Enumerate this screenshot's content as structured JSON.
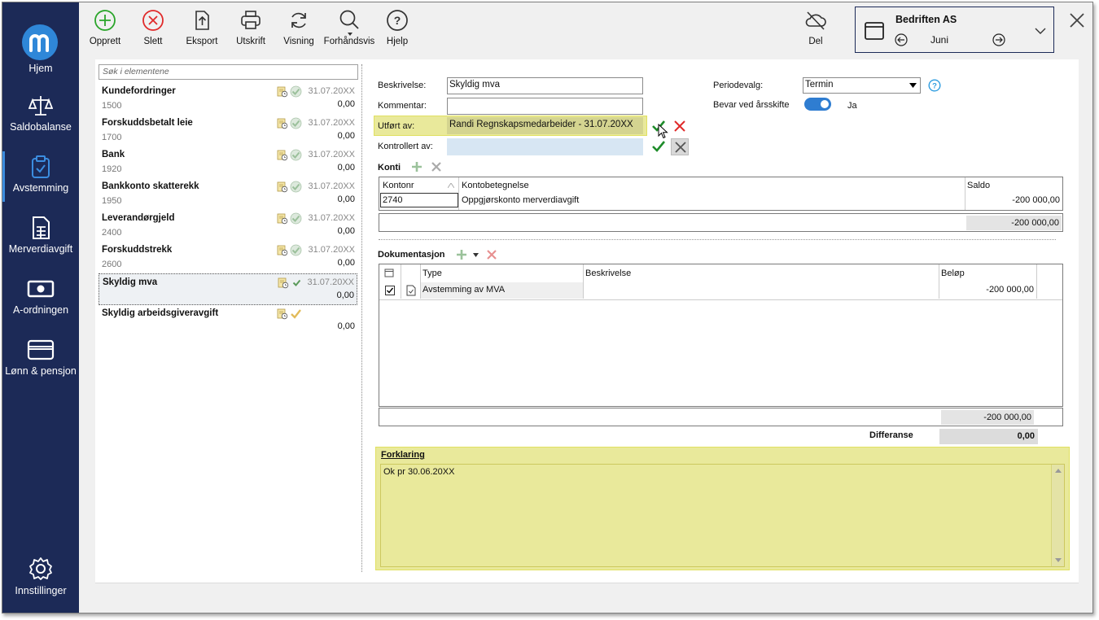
{
  "sidebar": {
    "items": [
      {
        "label": "Hjem",
        "icon": "m-logo-icon"
      },
      {
        "label": "Saldobalanse",
        "icon": "scales-icon"
      },
      {
        "label": "Avstemming",
        "icon": "clipboard-check-icon"
      },
      {
        "label": "Merverdiavgift",
        "icon": "document-icon"
      },
      {
        "label": "A-ordningen",
        "icon": "money-icon"
      },
      {
        "label": "Lønn & pensjon",
        "icon": "card-icon"
      }
    ],
    "settings": "Innstillinger"
  },
  "toolbar": {
    "opprett": "Opprett",
    "slett": "Slett",
    "eksport": "Eksport",
    "utskrift": "Utskrift",
    "visning": "Visning",
    "forhandsvis": "Forhåndsvis",
    "hjelp": "Hjelp",
    "del": "Del"
  },
  "company": {
    "name": "Bedriften AS",
    "period": "Juni"
  },
  "search": {
    "placeholder": "Søk i elementene"
  },
  "accounts": [
    {
      "name": "Kundefordringer",
      "num": "1500",
      "date": "31.07.20XX",
      "amount": "0,00"
    },
    {
      "name": "Forskuddsbetalt leie",
      "num": "1700",
      "date": "31.07.20XX",
      "amount": "0,00"
    },
    {
      "name": "Bank",
      "num": "1920",
      "date": "31.07.20XX",
      "amount": "0,00"
    },
    {
      "name": "Bankkonto skatterekk",
      "num": "1950",
      "date": "31.07.20XX",
      "amount": "0,00"
    },
    {
      "name": "Leverandørgjeld",
      "num": "2400",
      "date": "31.07.20XX",
      "amount": "0,00"
    },
    {
      "name": "Forskuddstrekk",
      "num": "2600",
      "date": "31.07.20XX",
      "amount": "0,00"
    },
    {
      "name": "Skyldig mva",
      "num": "",
      "date": "31.07.20XX",
      "amount": "0,00"
    },
    {
      "name": "Skyldig arbeidsgiveravgift",
      "num": "",
      "date": "",
      "amount": "0,00"
    }
  ],
  "form": {
    "beskrivelse_label": "Beskrivelse:",
    "beskrivelse_value": "Skyldig mva",
    "kommentar_label": "Kommentar:",
    "kommentar_value": "",
    "utfort_label": "Utført av:",
    "utfort_value": "Randi Regnskapsmedarbeider - 31.07.20XX",
    "kontrollert_label": "Kontrollert av:",
    "kontrollert_value": "",
    "periodevalg_label": "Periodevalg:",
    "periodevalg_value": "Termin",
    "bevar_label": "Bevar ved årsskifte",
    "bevar_value": "Ja"
  },
  "konti": {
    "title": "Konti",
    "headers": [
      "Kontonr",
      "Kontobetegnelse",
      "Saldo"
    ],
    "rows": [
      {
        "kontonr": "2740",
        "betegnelse": "Oppgjørskonto merverdiavgift",
        "saldo": "-200 000,00"
      }
    ],
    "total": "-200 000,00"
  },
  "dokumentasjon": {
    "title": "Dokumentasjon",
    "headers": [
      "Type",
      "Beskrivelse",
      "Beløp"
    ],
    "rows": [
      {
        "type": "Avstemming av MVA",
        "beskrivelse": "",
        "belop": "-200 000,00"
      }
    ],
    "total": "-200 000,00",
    "differanse_label": "Differanse",
    "differanse_value": "0,00"
  },
  "forklaring": {
    "title": "Forklaring",
    "text": "Ok pr 30.06.20XX"
  },
  "colors": {
    "sidebar": "#1c2a57",
    "accent": "#2f87d8",
    "highlight": "#e9e99b"
  }
}
